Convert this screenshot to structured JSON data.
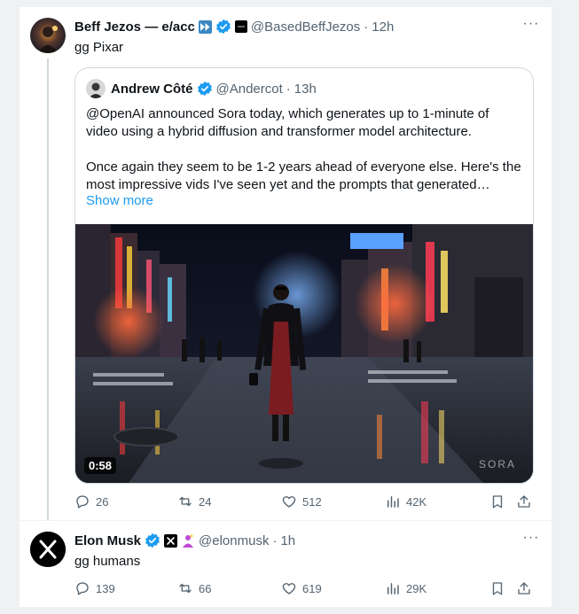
{
  "colors": {
    "accent": "#1d9bf0",
    "text": "#0f1419",
    "muted": "#536471",
    "border": "#cfd9de"
  },
  "tweet1": {
    "name": "Beff Jezos — e/acc",
    "handle": "@BasedBeffJezos",
    "separator": "·",
    "time": "12h",
    "text": "gg Pixar",
    "quote": {
      "name": "Andrew Côté",
      "handle": "@Andercot",
      "separator": "·",
      "time": "13h",
      "paragraph1": "@OpenAI announced Sora today, which generates up to 1-minute of video using a hybrid diffusion and transformer model architecture.",
      "paragraph2": "Once again they seem to be 1-2 years ahead of everyone else. Here's the most impressive vids I've seen yet and the prompts that generated…",
      "show_more": "Show more",
      "video_duration": "0:58"
    },
    "actions": {
      "replies": "26",
      "reposts": "24",
      "likes": "512",
      "views": "42K"
    }
  },
  "tweet2": {
    "name": "Elon Musk",
    "handle": "@elonmusk",
    "separator": "·",
    "time": "1h",
    "text": "gg humans",
    "actions": {
      "replies": "139",
      "reposts": "66",
      "likes": "619",
      "views": "29K"
    }
  }
}
